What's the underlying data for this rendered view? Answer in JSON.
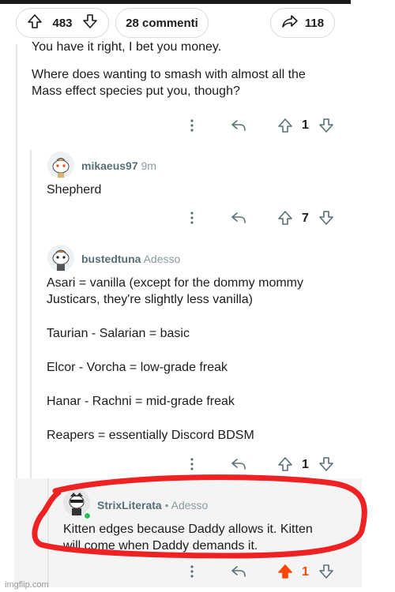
{
  "post_bar": {
    "upvotes": "483",
    "comments_label": "28 commenti",
    "shares": "118"
  },
  "comment1": {
    "line1": "You have it right, I bet you money.",
    "line2": "Where does wanting to smash with almost all the",
    "line3": "Mass effect species put you, though?",
    "score": "1"
  },
  "comment2": {
    "username": "mikaeus97",
    "time": "9m",
    "body": "Shepherd",
    "score": "7"
  },
  "comment3": {
    "username": "bustedtuna",
    "time": "Adesso",
    "lines": [
      "Asari = vanilla (except for the dommy mommy",
      "Justicars, they're slightly less vanilla)",
      "Taurian - Salarian = basic",
      "Elcor - Vorcha = low-grade freak",
      "Hanar - Rachni = mid-grade freak",
      "Reapers = essentially Discord BDSM"
    ],
    "score": "1"
  },
  "comment4": {
    "username": "StrixLiterata",
    "separator": "•",
    "time": "Adesso",
    "line1": "Kitten edges because Daddy allows it. Kitten",
    "line2": "will come when Daddy demands it.",
    "score": "1"
  },
  "watermark": "imgflip.com",
  "colors": {
    "upvoted": "#ff4500",
    "red_circle": "#ee2222",
    "thread_line": "#e3e5e6",
    "username": "#576f76"
  },
  "icons": [
    "upvote-icon",
    "downvote-icon",
    "comment-icon",
    "share-icon",
    "more-icon",
    "reply-icon"
  ]
}
